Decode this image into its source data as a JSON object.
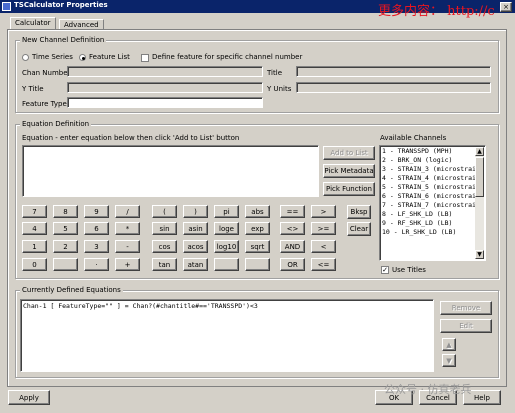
{
  "window": {
    "title": "TSCalculator Properties",
    "close_glyph": "×"
  },
  "watermark": {
    "top_text": "更多内容：  http://c",
    "bottom_text": "公众号 · 仿真老兵"
  },
  "tabs": [
    {
      "label": "Calculator"
    },
    {
      "label": "Advanced"
    }
  ],
  "new_channel": {
    "group_label": "New Channel Definition",
    "time_series_label": "Time Series",
    "feature_list_label": "Feature List",
    "define_feature_label": "Define feature for specific channel number",
    "chan_number_label": "Chan Number",
    "title_label": "Title",
    "y_title_label": "Y Title",
    "y_units_label": "Y Units",
    "feature_type_label": "Feature Type",
    "time_series_selected": false,
    "feature_list_selected": true,
    "define_feature_checked": false
  },
  "equation": {
    "group_label": "Equation Definition",
    "instruction": "Equation - enter equation below then click 'Add to List' button",
    "add_to_list": "Add to List",
    "pick_metadata": "Pick Metadata",
    "pick_function": "Pick Function",
    "keypad": [
      [
        "7",
        "8",
        "9",
        "/",
        "(",
        ")",
        "pi",
        "abs",
        "==",
        ">",
        "Bksp"
      ],
      [
        "4",
        "5",
        "6",
        "*",
        "sin",
        "asin",
        "loge",
        "exp",
        "<>",
        ">=",
        "Clear"
      ],
      [
        "1",
        "2",
        "3",
        "-",
        "cos",
        "acos",
        "log10",
        "sqrt",
        "AND",
        "<"
      ],
      [
        "0",
        "",
        "·",
        "+",
        "tan",
        "atan",
        "",
        "",
        "OR",
        "<="
      ]
    ]
  },
  "channels": {
    "label": "Available Channels",
    "items": [
      "1 - TRANSSPD (MPH)",
      "2 - BRK_ON (logic)",
      "3 - STRAIN_3 (microstrain)",
      "4 - STRAIN_4 (microstrain)",
      "5 - STRAIN_5 (microstrain)",
      "6 - STRAIN_6 (microstrain)",
      "7 - STRAIN_7 (microstrain)",
      "8 - LF_SHK_LD (LB)",
      "9 - RF_SHK_LD (LB)",
      "10 - LR_SHK_LD (LB)"
    ],
    "use_titles_label": "Use Titles",
    "use_titles_checked": true
  },
  "defined": {
    "group_label": "Currently Defined Equations",
    "items": [
      "Chan-1 [ FeatureType=\"\" ] = Chan?(#chantitle#=='TRANSSPD')<3"
    ],
    "remove": "Remove",
    "edit": "Edit",
    "up": "▲",
    "down": "▼"
  },
  "footer": {
    "apply": "Apply",
    "ok": "OK",
    "cancel": "Cancel",
    "help": "Help"
  }
}
